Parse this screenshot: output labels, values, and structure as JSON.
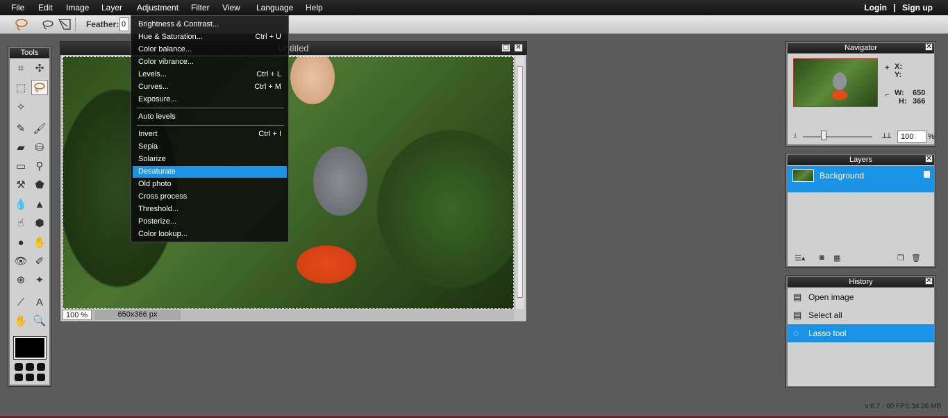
{
  "menubar": {
    "items": [
      "File",
      "Edit",
      "Image",
      "Layer",
      "Adjustment",
      "Filter",
      "View",
      "Language",
      "Help"
    ],
    "login": "Login",
    "separator": "|",
    "signup": "Sign up"
  },
  "optbar": {
    "feather_label": "Feather:",
    "feather_value": "0"
  },
  "tools": {
    "title": "Tools"
  },
  "canvas": {
    "title": "Untitled",
    "zoom": "100 %",
    "dimensions": "650x366 px"
  },
  "adjustment_menu": {
    "items": [
      {
        "label": "Brightness & Contrast...",
        "shortcut": ""
      },
      {
        "label": "Hue & Saturation...",
        "shortcut": "Ctrl + U"
      },
      {
        "label": "Color balance...",
        "shortcut": ""
      },
      {
        "label": "Color vibrance...",
        "shortcut": ""
      },
      {
        "label": "Levels...",
        "shortcut": "Ctrl + L"
      },
      {
        "label": "Curves...",
        "shortcut": "Ctrl + M"
      },
      {
        "label": "Exposure...",
        "shortcut": ""
      },
      {
        "label": "Auto levels",
        "shortcut": ""
      },
      {
        "label": "Invert",
        "shortcut": "Ctrl + I"
      },
      {
        "label": "Sepia",
        "shortcut": ""
      },
      {
        "label": "Solarize",
        "shortcut": ""
      },
      {
        "label": "Desaturate",
        "shortcut": ""
      },
      {
        "label": "Old photo",
        "shortcut": ""
      },
      {
        "label": "Cross process",
        "shortcut": ""
      },
      {
        "label": "Threshold...",
        "shortcut": ""
      },
      {
        "label": "Posterize...",
        "shortcut": ""
      },
      {
        "label": "Color lookup...",
        "shortcut": ""
      }
    ],
    "highlighted": "Desaturate"
  },
  "navigator": {
    "title": "Navigator",
    "x_label": "X:",
    "y_label": "Y:",
    "w_label": "W:",
    "w_value": "650",
    "h_label": "H:",
    "h_value": "366",
    "zoom_value": "100",
    "zoom_unit": "%"
  },
  "layers": {
    "title": "Layers",
    "items": [
      "Background"
    ]
  },
  "history": {
    "title": "History",
    "items": [
      "Open image",
      "Select all",
      "Lasso tool"
    ],
    "selected": "Lasso tool"
  },
  "footer": {
    "version": "v:6.7 - 60 FPS 34.26 MB"
  },
  "colors": {
    "accent": "#1a93e6",
    "foreground_swatch": "#000000"
  }
}
